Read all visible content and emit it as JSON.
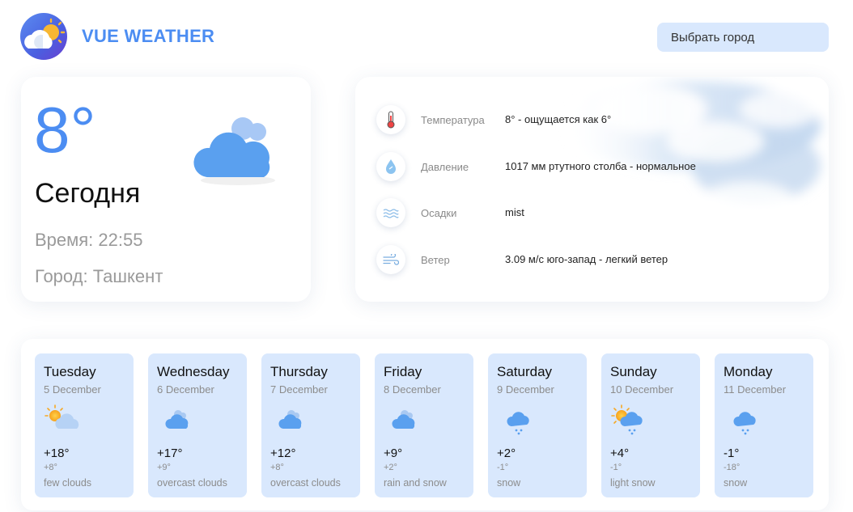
{
  "app": {
    "title": "VUE WEATHER",
    "select_city_label": "Выбрать город",
    "accent_color": "#4c8df2",
    "card_blue": "#d9e8fd"
  },
  "today": {
    "temperature": "8°",
    "label": "Сегодня",
    "time": "Время: 22:55",
    "city": "Город: Ташкент",
    "icon": "cloud-icon"
  },
  "details": [
    {
      "icon": "thermometer-icon",
      "label": "Температура",
      "value": "8° - ощущается как 6°"
    },
    {
      "icon": "water-drop-icon",
      "label": "Давление",
      "value": "1017 мм ртутного столба - нормальное"
    },
    {
      "icon": "precipitation-icon",
      "label": "Осадки",
      "value": "mist"
    },
    {
      "icon": "wind-icon",
      "label": "Ветер",
      "value": "3.09 м/с юго-запад - легкий ветер"
    }
  ],
  "forecast": [
    {
      "day": "Tuesday",
      "date": "5 December",
      "max": "+18°",
      "min": "+8°",
      "desc": "few clouds",
      "icon": "sun-cloud-icon"
    },
    {
      "day": "Wednesday",
      "date": "6 December",
      "max": "+17°",
      "min": "+9°",
      "desc": "overcast clouds",
      "icon": "clouds-icon"
    },
    {
      "day": "Thursday",
      "date": "7 December",
      "max": "+12°",
      "min": "+8°",
      "desc": "overcast clouds",
      "icon": "clouds-icon"
    },
    {
      "day": "Friday",
      "date": "8 December",
      "max": "+9°",
      "min": "+2°",
      "desc": "rain and snow",
      "icon": "clouds-icon"
    },
    {
      "day": "Saturday",
      "date": "9 December",
      "max": "+2°",
      "min": "-1°",
      "desc": "snow",
      "icon": "snow-cloud-icon"
    },
    {
      "day": "Sunday",
      "date": "10 December",
      "max": "+4°",
      "min": "-1°",
      "desc": "light snow",
      "icon": "sun-snow-cloud-icon"
    },
    {
      "day": "Monday",
      "date": "11 December",
      "max": "-1°",
      "min": "-18°",
      "desc": "snow",
      "icon": "snow-cloud-icon"
    }
  ]
}
